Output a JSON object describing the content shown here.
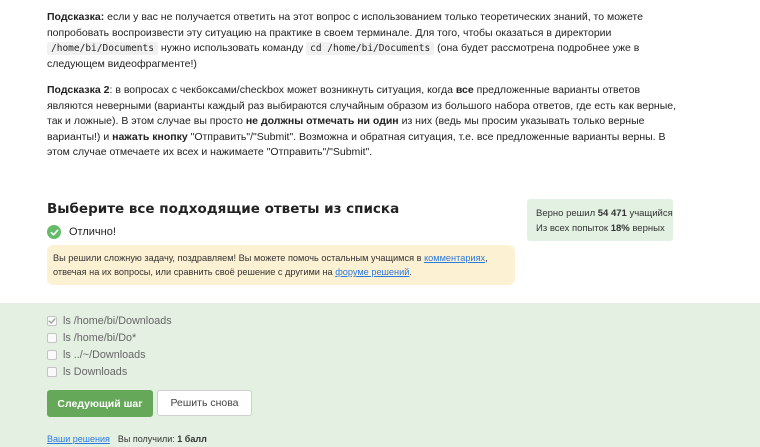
{
  "hints": {
    "hint1": {
      "label": "Подсказка:",
      "text_a": " если у вас не получается ответить на этот вопрос с использованием только теоретических знаний, то можете попробовать воспроизвести эту ситуацию на практике в своем терминале. Для того, чтобы оказаться в директории ",
      "code_dir": "/home/bi/Documents",
      "text_b": " нужно использовать команду ",
      "code_cmd": "cd /home/bi/Documents",
      "text_c": " (она будет рассмотрена подробнее уже в следующем видеофрагменте!)"
    },
    "hint2": {
      "label": "Подсказка 2",
      "text_a": ": в вопросах с чекбоксами/checkbox может возникнуть ситуация, когда ",
      "bold_all": "все",
      "text_b": " предложенные варианты ответов являются неверными (варианты каждый раз выбираются случайным образом из большого набора ответов, где есть как верные, так и ложные). В этом случае вы просто ",
      "bold_no": "не должны",
      "text_c": " ",
      "bold_mark": "отмечать ни один",
      "text_d": " из них (ведь мы просим указывать только верные варианты!) и ",
      "bold_press": "нажать кнопку",
      "text_e": " \"Отправить\"/\"Submit\". Возможна и обратная ситуация, т.е. все предложенные варианты верны. В этом случае отмечаете их всех и нажимаете \"Отправить\"/\"Submit\"."
    }
  },
  "task": {
    "title": "Выберите все подходящие ответы из списка",
    "status": "Отлично!"
  },
  "stats": {
    "solved_prefix": "Верно решил ",
    "solved_count": "54 471",
    "solved_suffix": " учащийся",
    "attempts_prefix": "Из всех попыток ",
    "attempts_pct": "18%",
    "attempts_suffix": " верных"
  },
  "feedback": {
    "text_a": "Вы решили сложную задачу, поздравляем! Вы можете помочь остальным учащимся в ",
    "link_comments": "комментариях",
    "text_b": ", отвечая на их вопросы, или сравнить своё решение с другими на ",
    "link_forum": "форуме решений",
    "text_c": "."
  },
  "options": [
    {
      "label": "ls /home/bi/Downloads",
      "checked": true
    },
    {
      "label": "ls /home/bi/Do*",
      "checked": false
    },
    {
      "label": "ls ../~/Downloads",
      "checked": false
    },
    {
      "label": "ls Downloads",
      "checked": false
    }
  ],
  "buttons": {
    "next": "Следующий шаг",
    "retry": "Решить снова"
  },
  "footer": {
    "solutions_link": "Ваши решения",
    "score_prefix": "Вы получили: ",
    "score": "1 балл"
  },
  "colors": {
    "accent_green": "#66a85a",
    "answer_bg": "#e4f0e2",
    "feedback_bg": "#fdf1d3",
    "link": "#2a7ae2"
  }
}
